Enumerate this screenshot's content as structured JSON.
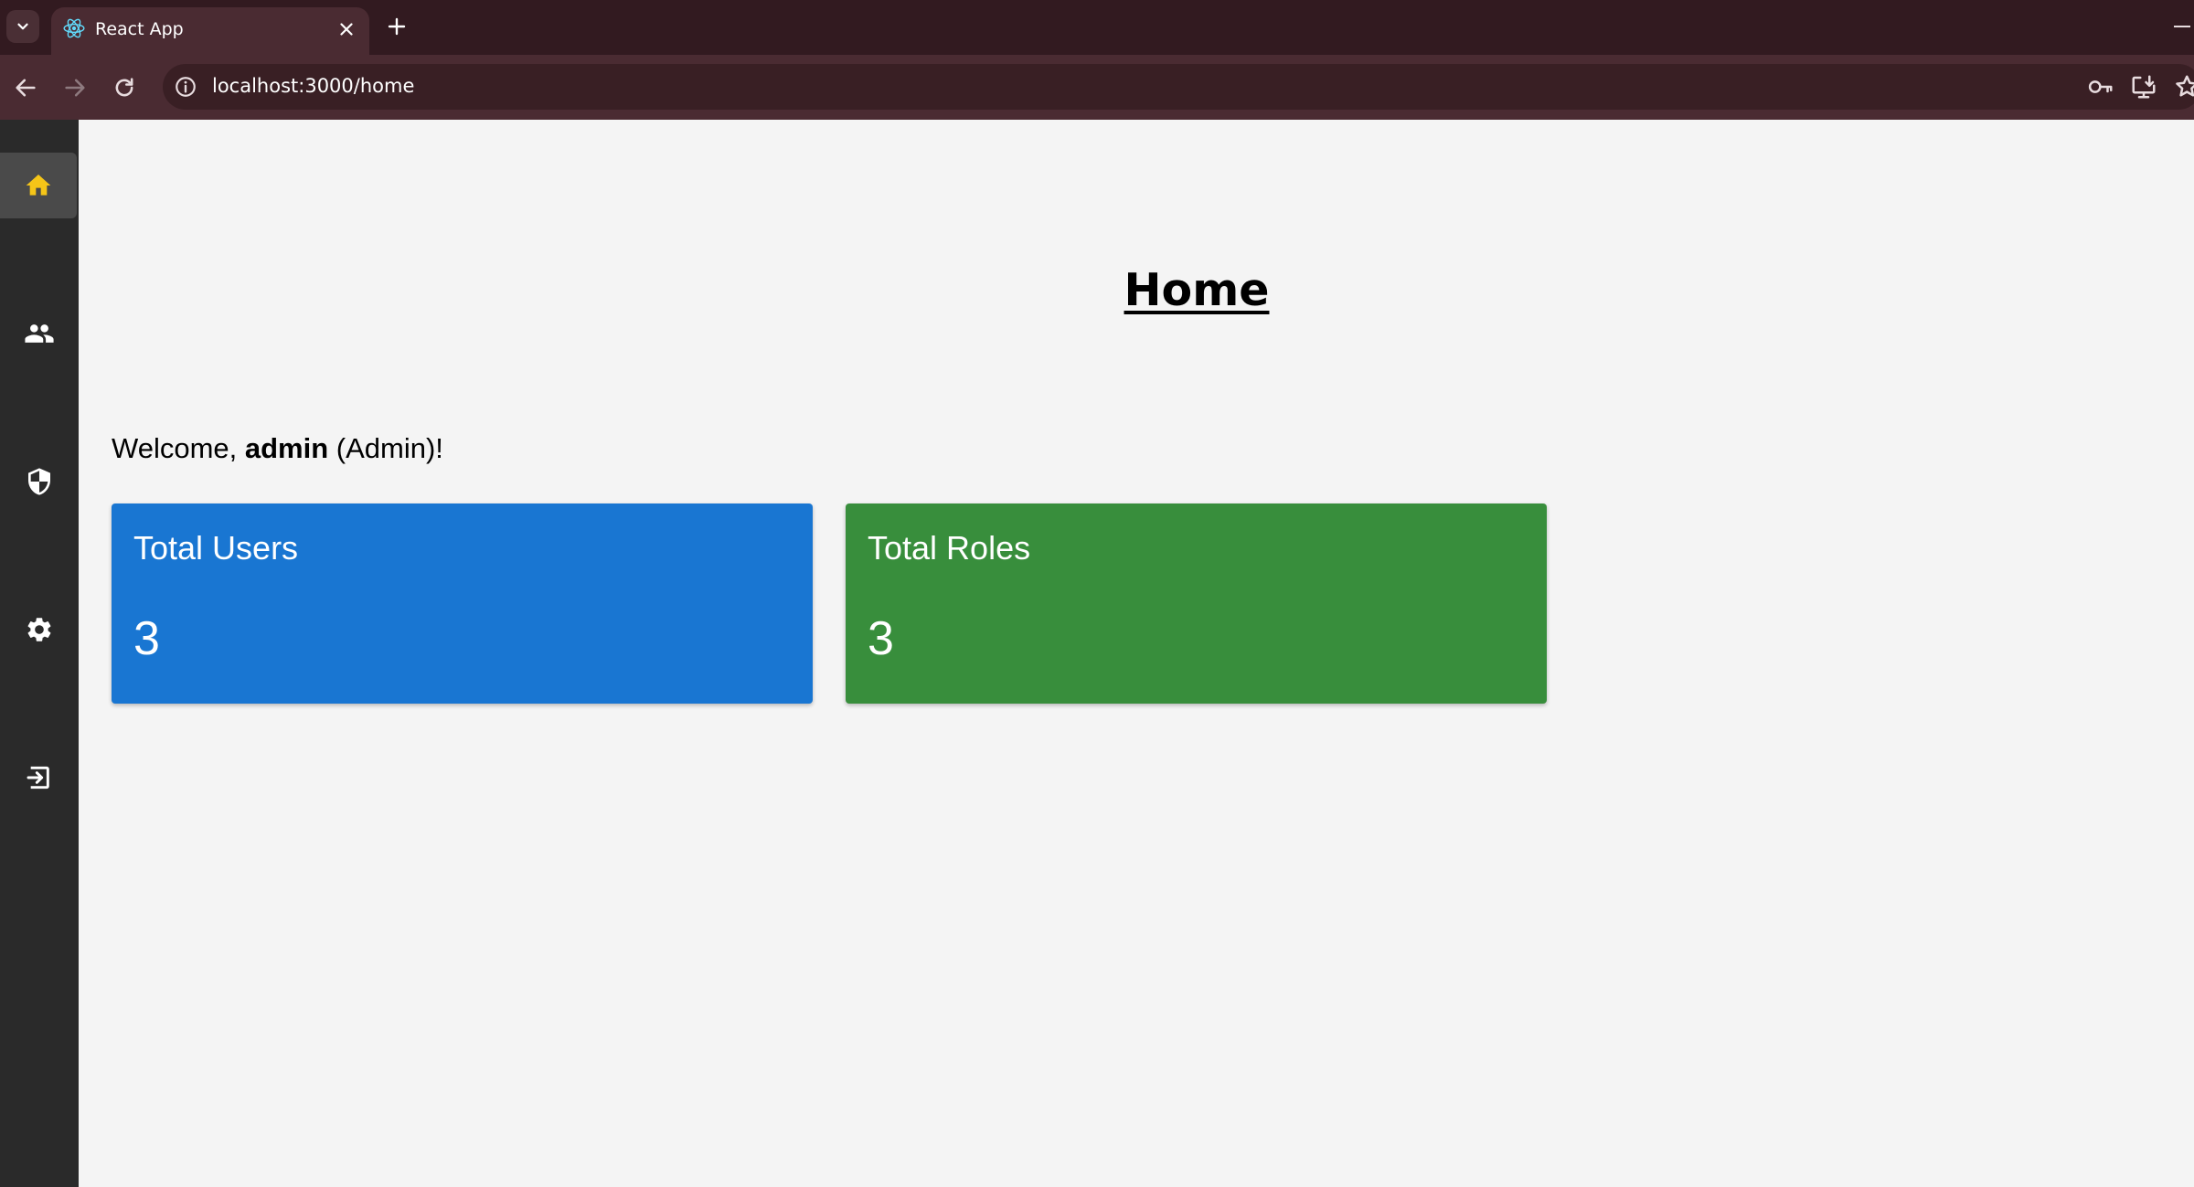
{
  "browser": {
    "tab_title": "React App",
    "url": "localhost:3000/home"
  },
  "sidebar": {
    "items": [
      {
        "name": "home",
        "icon": "home-icon",
        "active": true,
        "icon_color": "#f5c518"
      },
      {
        "name": "users",
        "icon": "users-icon",
        "active": false
      },
      {
        "name": "roles",
        "icon": "shield-icon",
        "active": false
      },
      {
        "name": "settings",
        "icon": "gear-icon",
        "active": false
      },
      {
        "name": "logout",
        "icon": "logout-icon",
        "active": false
      }
    ]
  },
  "page": {
    "title": "Home",
    "welcome_prefix": "Welcome, ",
    "username": "admin",
    "welcome_suffix": " (Admin)!"
  },
  "cards": [
    {
      "title": "Total Users",
      "value": "3",
      "color": "#1976d2"
    },
    {
      "title": "Total Roles",
      "value": "3",
      "color": "#388e3c"
    }
  ]
}
